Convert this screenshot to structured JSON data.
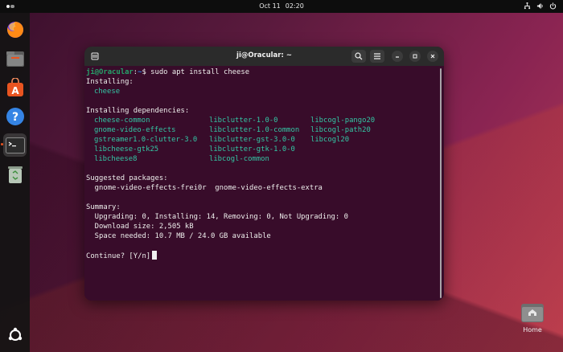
{
  "topbar": {
    "date": "Oct 11",
    "time": "02:20"
  },
  "dock": {
    "items": [
      {
        "name": "firefox"
      },
      {
        "name": "files"
      },
      {
        "name": "app-center"
      },
      {
        "name": "help"
      },
      {
        "name": "terminal"
      },
      {
        "name": "trash"
      }
    ]
  },
  "window": {
    "title": "ji@Oracular: ~"
  },
  "terminal": {
    "prompt_user": "ji@Oracular",
    "prompt_sep": ":",
    "prompt_path": "~",
    "prompt_symbol": "$",
    "command": "sudo apt install cheese",
    "installing_label": "Installing:",
    "installing_pkg": "cheese",
    "deps_label": "Installing dependencies:",
    "deps": [
      [
        "cheese-common",
        "libclutter-1.0-0",
        "libcogl-pango20"
      ],
      [
        "gnome-video-effects",
        "libclutter-1.0-common",
        "libcogl-path20"
      ],
      [
        "gstreamer1.0-clutter-3.0",
        "libclutter-gst-3.0-0",
        "libcogl20"
      ],
      [
        "libcheese-gtk25",
        "libclutter-gtk-1.0-0",
        ""
      ],
      [
        "libcheese8",
        "libcogl-common",
        ""
      ]
    ],
    "suggested_label": "Suggested packages:",
    "suggested": "  gnome-video-effects-frei0r  gnome-video-effects-extra",
    "summary_label": "Summary:",
    "summary_upgrading": "  Upgrading: 0, Installing: 14, Removing: 0, Not Upgrading: 0",
    "summary_download": "  Download size: 2,505 kB",
    "summary_space": "  Space needed: 10.7 MB / 24.0 GB available",
    "continue_prompt": "Continue? [Y/n]"
  },
  "desktop": {
    "home_label": "Home"
  },
  "colors": {
    "terminal_bg": "#380c2a",
    "prompt_green": "#26a269",
    "path_blue": "#2a7bde",
    "accent": "#e95420"
  }
}
